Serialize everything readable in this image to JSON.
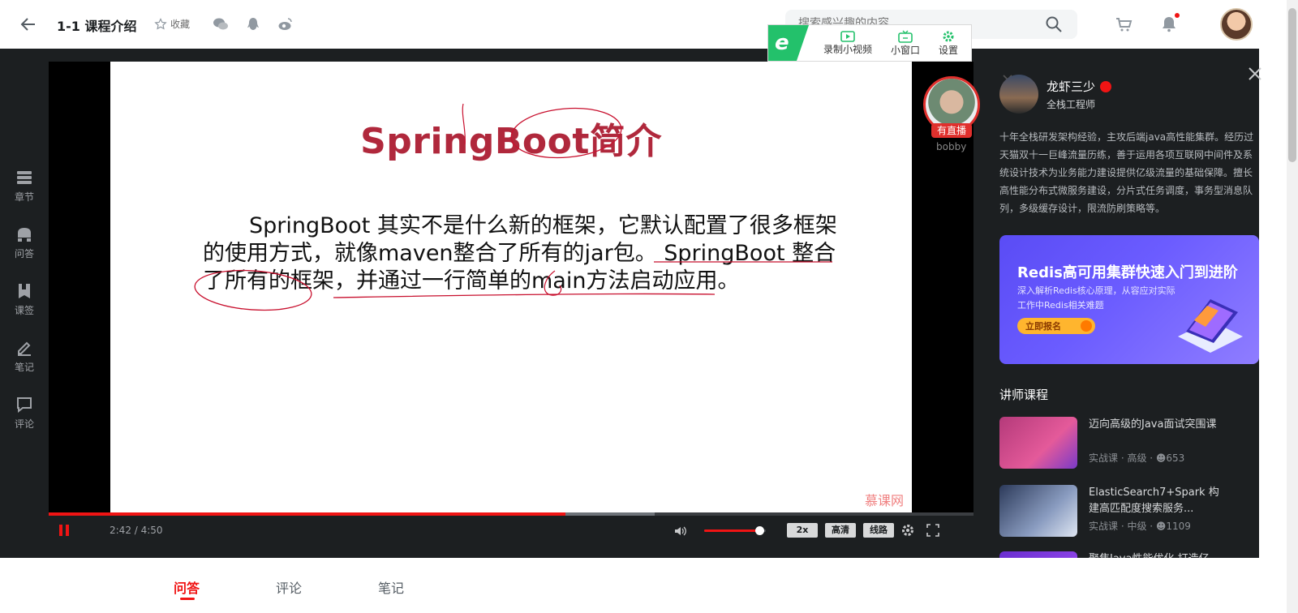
{
  "header": {
    "course_title": "1-1 课程介绍",
    "favorite_label": "收藏",
    "search_placeholder": "搜索感兴趣的内容"
  },
  "plugin": {
    "logo": "e",
    "record_label": "录制小视频",
    "mini_label": "小窗口",
    "settings_label": "设置"
  },
  "left_rail": {
    "items": [
      {
        "label": "章节",
        "icon": "chapter-icon"
      },
      {
        "label": "问答",
        "icon": "qa-icon"
      },
      {
        "label": "课签",
        "icon": "bookmark-icon"
      },
      {
        "label": "笔记",
        "icon": "pencil-icon"
      },
      {
        "label": "评论",
        "icon": "comment-icon"
      }
    ]
  },
  "slide": {
    "title": "SpringBoot简介",
    "body": "SpringBoot 其实不是什么新的框架，它默认配置了很多框架的使用方式，就像maven整合了所有的jar包。 SpringBoot 整合了所有的框架，并通过一行简单的main方法启动应用。",
    "brand": "慕课网"
  },
  "live": {
    "badge": "有直播",
    "name": "bobby"
  },
  "player": {
    "current_time": "2:42",
    "duration": "4:50",
    "time_text": "2:42 / 4:50",
    "progress": 0.559,
    "buffered_to": 0.655,
    "volume": 0.9,
    "speed_label": "2x",
    "quality_label": "高清",
    "line_label": "线路"
  },
  "teacher": {
    "name": "龙虾三少",
    "role": "全栈工程师",
    "bio": "十年全栈研发架构经验，主攻后端java高性能集群。经历过天猫双十一巨峰流量历练，善于运用各项互联网中间件及系统设计技术为业务能力建设提供亿级流量的基础保障。擅长高性能分布式微服务建设，分片式任务调度，事务型消息队列，多级缓存设计，限流防刷策略等。"
  },
  "banner": {
    "title": "Redis高可用集群快速入门到进阶",
    "sub1": "深入解析Redis核心原理，从容应对实际",
    "sub2": "工作中Redis相关难题",
    "button": "立即报名"
  },
  "courses": {
    "section_title": "讲师课程",
    "items": [
      {
        "title": "迈向高级的Java面试突围课",
        "meta": "实战课 · 高级 · ",
        "count": "653"
      },
      {
        "title": "ElasticSearch7+Spark 构建高匹配度搜索服务...",
        "meta": "实战课 · 中级 · ",
        "count": "1109"
      },
      {
        "title": "聚焦Java性能优化 打造亿...",
        "meta": "",
        "count": ""
      }
    ]
  },
  "bottom_tabs": [
    {
      "label": "问答",
      "active": true
    },
    {
      "label": "评论",
      "active": false
    },
    {
      "label": "笔记",
      "active": false
    }
  ],
  "colors": {
    "accent": "#f01414",
    "dark_bg": "#1c1f21",
    "slide_title": "#b0283c",
    "banner": "#6b5cff",
    "plugin_green": "#23c16b"
  }
}
